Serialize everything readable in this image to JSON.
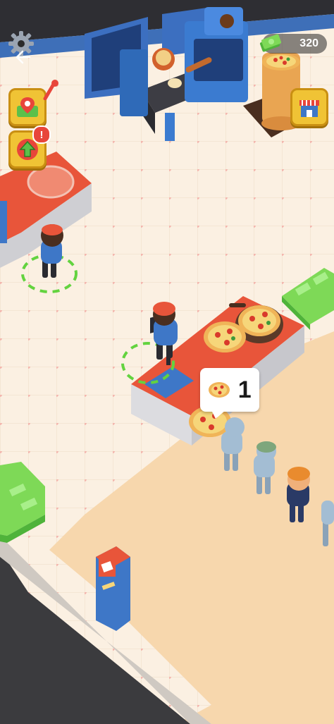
{
  "hud": {
    "money_amount": "320",
    "money_icon": "cash-icon",
    "settings_icon": "gear-icon",
    "back_icon": "back-arrow-icon",
    "map_button_icon": "map-pin-icon",
    "upgrade_button_icon": "upgrade-arrow-icon",
    "upgrade_alert_icon": "exclamation-icon",
    "shop_button_icon": "shop-icon"
  },
  "order": {
    "item_icon": "pizza-icon",
    "quantity": "1"
  },
  "colors": {
    "floor": "#f6e8d6",
    "counter_top": "#e8553a",
    "hud_button": "#f0c335",
    "cash": "#7ed957",
    "accent_blue": "#3e77c7"
  }
}
